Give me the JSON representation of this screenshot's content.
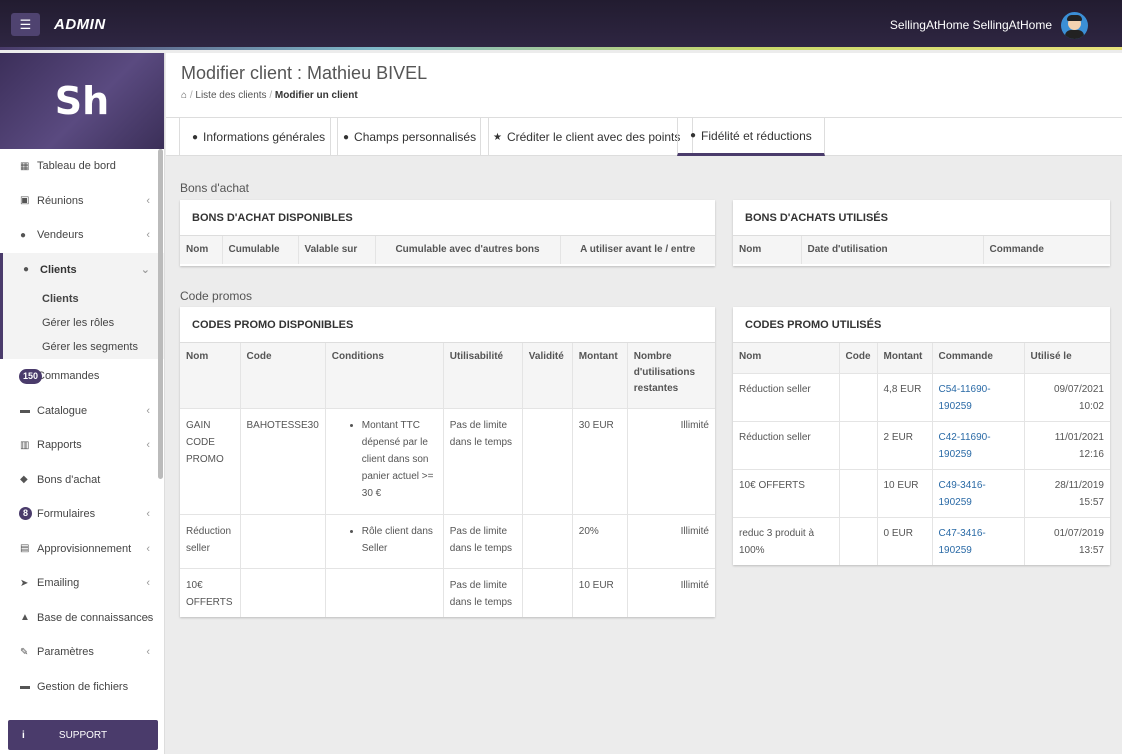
{
  "topbar": {
    "brand": "ADMIN",
    "menu_icon": "☰",
    "user_name": "SellingAtHome SellingAtHome"
  },
  "sidebar": {
    "logo": "Sh",
    "items": [
      {
        "label": "Tableau de bord",
        "icon": "▦"
      },
      {
        "label": "Réunions",
        "icon": "▣"
      },
      {
        "label": "Vendeurs",
        "icon": "●"
      },
      {
        "label": "Clients",
        "icon": "●"
      },
      {
        "label": "Commandes",
        "badge": "150"
      },
      {
        "label": "Catalogue",
        "icon": "▬"
      },
      {
        "label": "Rapports",
        "icon": "▥"
      },
      {
        "label": "Bons d'achat",
        "icon": "◆"
      },
      {
        "label": "Formulaires",
        "badge": "8"
      },
      {
        "label": "Approvisionnement",
        "icon": "▤"
      },
      {
        "label": "Emailing",
        "icon": "➤"
      },
      {
        "label": "Base de connaissances",
        "icon": "▲"
      },
      {
        "label": "Paramètres",
        "icon": "✎"
      },
      {
        "label": "Gestion de fichiers",
        "icon": "▬"
      }
    ],
    "sub_items": [
      "Clients",
      "Gérer les rôles",
      "Gérer les segments"
    ],
    "support": "SUPPORT"
  },
  "header": {
    "title": "Modifier client : Mathieu BIVEL",
    "breadcrumb": {
      "home_icon": "⌂",
      "list": "Liste des clients",
      "current": "Modifier un client"
    }
  },
  "tabs": [
    "Informations générales",
    "Champs personnalisés",
    "Créditer le client avec des points",
    "Fidélité et réductions"
  ],
  "sections": {
    "bons": "Bons d'achat",
    "promos": "Code promos"
  },
  "bons_dispo": {
    "title": "BONS D'ACHAT DISPONIBLES",
    "headers": [
      "Nom",
      "Cumulable",
      "Valable sur",
      "Cumulable avec d'autres bons",
      "A utiliser avant le / entre"
    ]
  },
  "bons_utilises": {
    "title": "BONS D'ACHATS UTILISÉS",
    "headers": [
      "Nom",
      "Date d'utilisation",
      "Commande"
    ]
  },
  "promo_dispo": {
    "title": "CODES PROMO DISPONIBLES",
    "headers": [
      "Nom",
      "Code",
      "Conditions",
      "Utilisabilité",
      "Validité",
      "Montant",
      "Nombre d'utilisations restantes"
    ],
    "rows": [
      {
        "nom": "GAIN CODE PROMO",
        "code": "BAHOTESSE30",
        "condition": "Montant TTC dépensé par le client dans son panier actuel >= 30 €",
        "util": "Pas de limite dans le temps",
        "validite": "",
        "montant": "30 EUR",
        "restant": "Illimité"
      },
      {
        "nom": "Réduction seller",
        "code": "",
        "condition": "Rôle client dans Seller",
        "util": "Pas de limite dans le temps",
        "validite": "",
        "montant": "20%",
        "restant": "Illimité"
      },
      {
        "nom": "10€ OFFERTS",
        "code": "",
        "condition": "",
        "util": "Pas de limite dans le temps",
        "validite": "",
        "montant": "10 EUR",
        "restant": "Illimité"
      }
    ]
  },
  "promo_utilises": {
    "title": "CODES PROMO UTILISÉS",
    "headers": [
      "Nom",
      "Code",
      "Montant",
      "Commande",
      "Utilisé le"
    ],
    "rows": [
      {
        "nom": "Réduction seller",
        "code": "",
        "montant": "4,8 EUR",
        "commande": "C54-11690-190259",
        "date": "09/07/2021 10:02"
      },
      {
        "nom": "Réduction seller",
        "code": "",
        "montant": "2 EUR",
        "commande": "C42-11690-190259",
        "date": "11/01/2021 12:16"
      },
      {
        "nom": "10€ OFFERTS",
        "code": "",
        "montant": "10 EUR",
        "commande": "C49-3416-190259",
        "date": "28/11/2019 15:57"
      },
      {
        "nom": "reduc 3 produit à 100%",
        "code": "",
        "montant": "0 EUR",
        "commande": "C47-3416-190259",
        "date": "01/07/2019 13:57"
      }
    ]
  },
  "colors": {
    "brand": "#4a3b6b",
    "topbar": "#2a2239",
    "link": "#2a6aa6"
  }
}
